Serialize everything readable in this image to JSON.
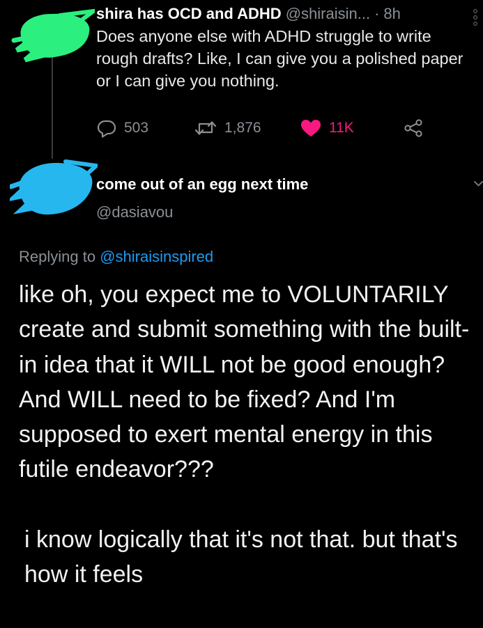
{
  "original_tweet": {
    "display_name": "shira has OCD and ADHD",
    "handle": "@shiraisin...",
    "separator": "·",
    "time": "8h",
    "text": "Does anyone else with ADHD struggle to write rough drafts? Like, I can give you a polished paper or I can give you nothing.",
    "avatar_color": "#2bef7e",
    "actions": {
      "replies": "503",
      "retweets": "1,876",
      "likes": "11K"
    },
    "icons": {
      "reply": "reply-bubble-icon",
      "retweet": "retweet-icon",
      "like": "heart-filled-icon",
      "share": "share-icon",
      "more": "more-options-icon"
    },
    "like_color": "#f91880"
  },
  "reply_tweet": {
    "display_name": "come out of an egg next time",
    "handle": "@dasiavou",
    "avatar_color": "#27b7ef",
    "replying_to_prefix": "Replying to",
    "replying_to_handle": "@shiraisinspired",
    "paragraph_1": "like oh, you expect me to VOLUNTARILY create and submit something with the built-in idea that it WILL not be good enough? And WILL need to be fixed? And I'm supposed to exert mental energy in this futile endeavor???",
    "paragraph_2": "i know logically that it's not that. but that's how it feels",
    "mention_color": "#1d9bf0"
  }
}
